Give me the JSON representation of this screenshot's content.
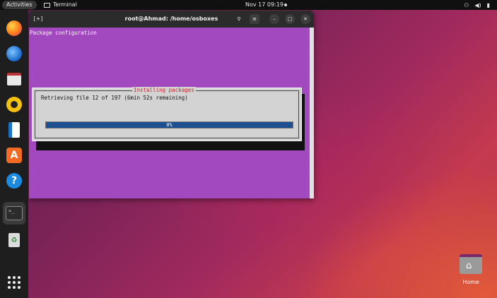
{
  "topbar": {
    "activities": "Activities",
    "app_name": "Terminal",
    "clock": "Nov 17  09:19",
    "sys_icons": [
      "network-icon",
      "volume-icon",
      "battery-icon"
    ]
  },
  "dock": {
    "items": [
      {
        "name": "firefox-icon"
      },
      {
        "name": "thunderbird-icon"
      },
      {
        "name": "files-icon"
      },
      {
        "name": "rhythmbox-icon"
      },
      {
        "name": "libreoffice-writer-icon"
      },
      {
        "name": "app-center-icon",
        "glyph": "A"
      },
      {
        "name": "help-icon",
        "glyph": "?"
      },
      {
        "name": "terminal-icon",
        "glyph": ">_"
      },
      {
        "name": "trash-icon",
        "glyph": "♻"
      },
      {
        "name": "show-apps-icon"
      }
    ]
  },
  "window": {
    "title": "root@Ahmad: /home/osboxes",
    "new_tab_glyph": "[+]",
    "search_glyph": "⚲",
    "menu_glyph": "≡",
    "min_glyph": "–",
    "max_glyph": "▢",
    "close_glyph": "✕"
  },
  "terminal": {
    "header": "Package configuration",
    "dialog_title": "Installing packages",
    "dialog_text": "Retrieving file 12 of 197 (6min 52s remaining)",
    "progress_label": "0%",
    "progress_fraction": 0.0
  },
  "desktop": {
    "home_label": "Home",
    "home_glyph": "⌂"
  }
}
